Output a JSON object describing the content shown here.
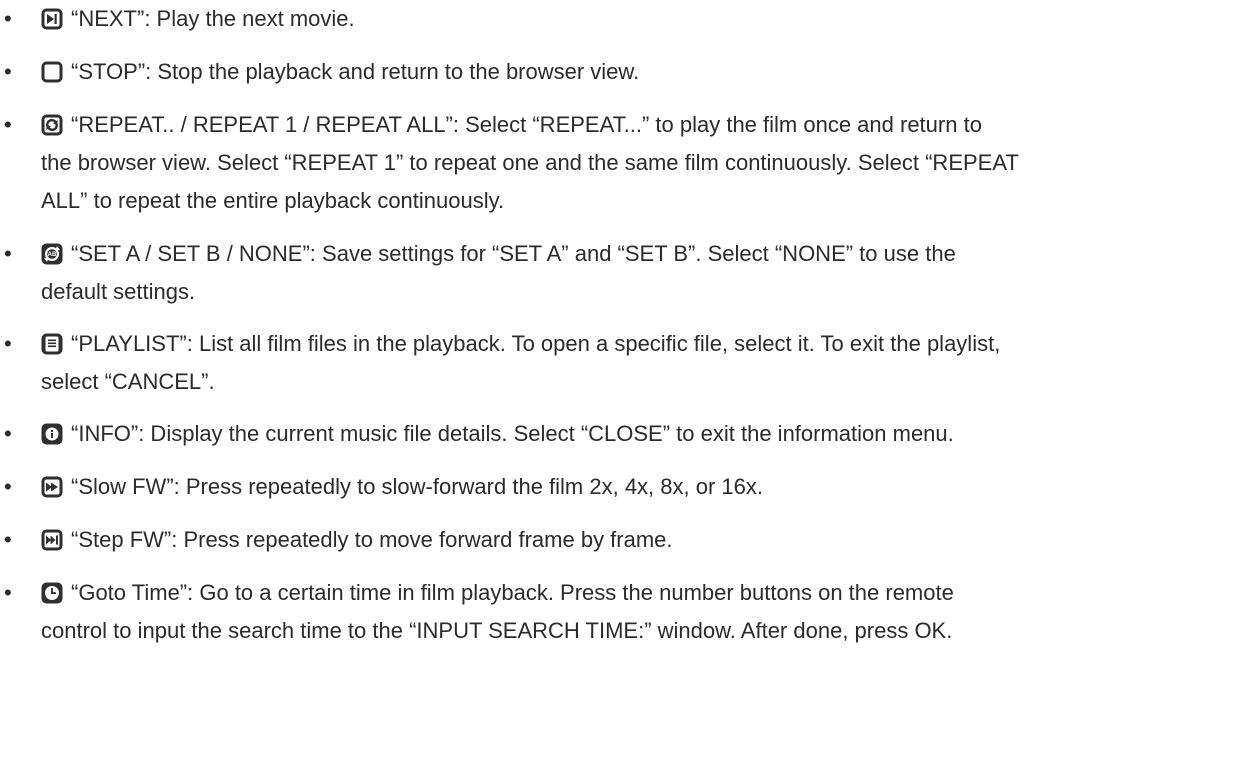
{
  "items": [
    {
      "icon": "next-icon",
      "text": "“NEXT”: Play the next movie."
    },
    {
      "icon": "stop-icon",
      "text": "“STOP”: Stop the playback and return to the browser view."
    },
    {
      "icon": "repeat-icon",
      "line1": "“REPEAT.. / REPEAT 1 / REPEAT ALL”: Select “REPEAT...” to play the film once and return to",
      "line2": "the browser view. Select “REPEAT 1” to repeat one and the same film continuously. Select “REPEAT",
      "line3": "ALL” to repeat the entire playback continuously."
    },
    {
      "icon": "ab-repeat-icon",
      "icon_text": "AB",
      "line1": "“SET A / SET B / NONE”: Save settings for “SET A” and “SET B”. Select “NONE” to use the",
      "line2": "default settings."
    },
    {
      "icon": "playlist-icon",
      "line1": "“PLAYLIST”: List all film files in the playback. To open a specific file, select it. To exit the playlist,",
      "line2": "select “CANCEL”."
    },
    {
      "icon": "info-icon",
      "text": "“INFO”: Display the current music file details. Select “CLOSE” to exit the information menu."
    },
    {
      "icon": "slow-forward-icon",
      "text": "“Slow FW”: Press repeatedly to slow-forward the film 2x, 4x, 8x, or 16x."
    },
    {
      "icon": "step-forward-icon",
      "text": "“Step FW”: Press repeatedly to move forward frame by frame."
    },
    {
      "icon": "clock-icon",
      "line1": "“Goto Time”: Go to a certain time in film playback. Press the number buttons on the remote",
      "line2": "control to input the search time to the “INPUT SEARCH TIME:” window. After done, press OK."
    }
  ],
  "bullet": "•",
  "colors": {
    "text": "#2b2b2b",
    "icon": "#2f2f2f"
  }
}
